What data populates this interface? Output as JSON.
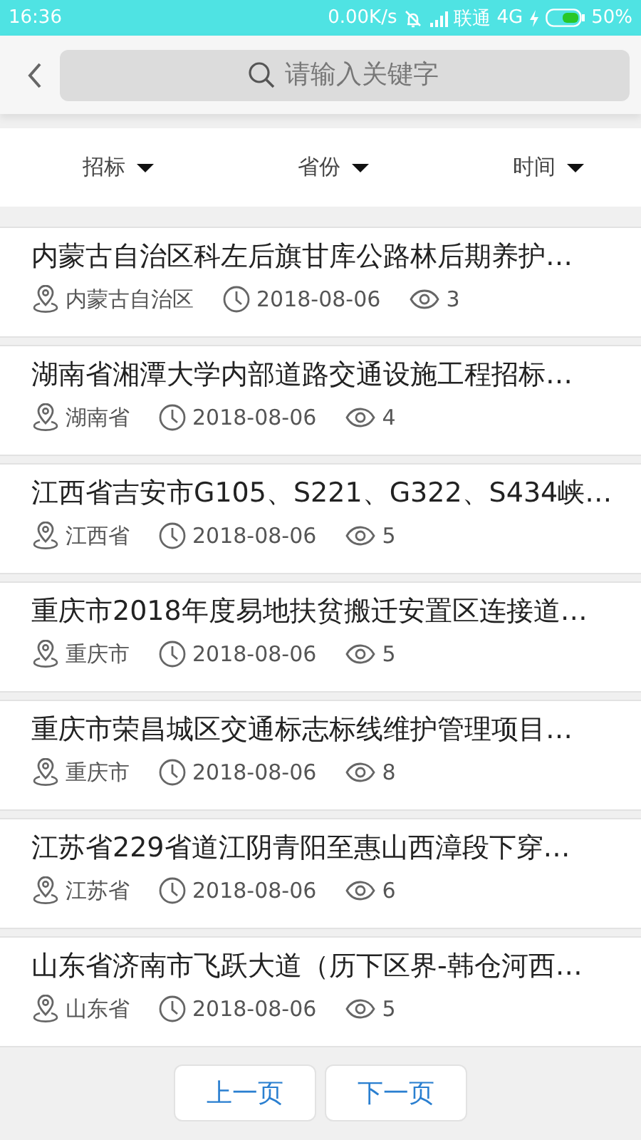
{
  "status_bar": {
    "time": "16:36",
    "speed": "0.00K/s",
    "carrier": "联通",
    "network": "4G",
    "battery": "50%"
  },
  "header": {
    "search": {
      "placeholder": "请输入关键字"
    }
  },
  "filters": [
    {
      "label": "招标"
    },
    {
      "label": "省份"
    },
    {
      "label": "时间"
    }
  ],
  "items": [
    {
      "title": "内蒙古自治区科左后旗甘库公路林后期养护…",
      "region": "内蒙古自治区",
      "date": "2018-08-06",
      "views": "3"
    },
    {
      "title": "湖南省湘潭大学内部道路交通设施工程招标…",
      "region": "湖南省",
      "date": "2018-08-06",
      "views": "4"
    },
    {
      "title": "江西省吉安市G105、S221、G322、S434峡…",
      "region": "江西省",
      "date": "2018-08-06",
      "views": "5"
    },
    {
      "title": "重庆市2018年度易地扶贫搬迁安置区连接道…",
      "region": "重庆市",
      "date": "2018-08-06",
      "views": "5"
    },
    {
      "title": "重庆市荣昌城区交通标志标线维护管理项目…",
      "region": "重庆市",
      "date": "2018-08-06",
      "views": "8"
    },
    {
      "title": "江苏省229省道江阴青阳至惠山西漳段下穿…",
      "region": "江苏省",
      "date": "2018-08-06",
      "views": "6"
    },
    {
      "title": "山东省济南市飞跃大道（历下区界-韩仓河西…",
      "region": "山东省",
      "date": "2018-08-06",
      "views": "5"
    }
  ],
  "pagination": [
    "上一页",
    "下一页"
  ]
}
